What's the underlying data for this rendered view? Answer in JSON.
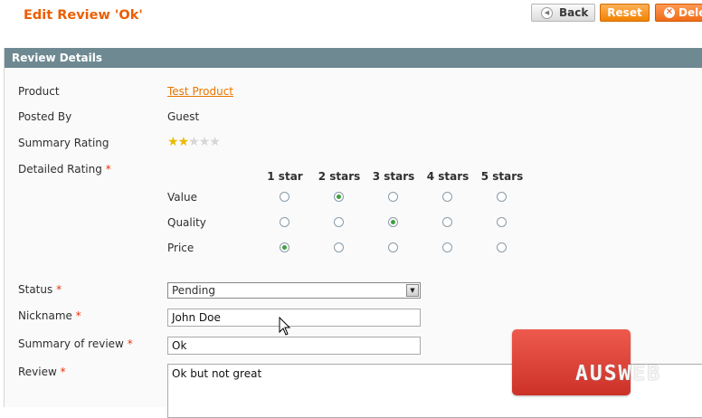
{
  "header": {
    "title": "Edit Review 'Ok'",
    "back_label": "Back",
    "reset_label": "Reset",
    "delete_label": "Dele"
  },
  "panel": {
    "title": "Review Details"
  },
  "fields": {
    "product_label": "Product",
    "product_value": "Test Product",
    "posted_by_label": "Posted By",
    "posted_by_value": "Guest",
    "summary_rating_label": "Summary Rating",
    "summary_rating_stars": 2,
    "summary_rating_max": 5,
    "detailed_rating_label": "Detailed Rating",
    "status_label": "Status",
    "status_value": "Pending",
    "nickname_label": "Nickname",
    "nickname_value": "John Doe",
    "summary_label": "Summary of review",
    "summary_value": "Ok",
    "review_label": "Review",
    "review_value": "Ok but not great",
    "required_mark": "*"
  },
  "rating_table": {
    "columns": [
      "1 star",
      "2 stars",
      "3 stars",
      "4 stars",
      "5 stars"
    ],
    "rows": [
      {
        "label": "Value",
        "selected": 2
      },
      {
        "label": "Quality",
        "selected": 3
      },
      {
        "label": "Price",
        "selected": 1
      }
    ]
  },
  "watermark": {
    "text": "AUSWEB",
    "color": "#e0453a"
  },
  "colors": {
    "accent": "#eb5e00",
    "panel_header": "#6f8992",
    "radio_selected": "#3da040",
    "star": "#ebbb00"
  }
}
